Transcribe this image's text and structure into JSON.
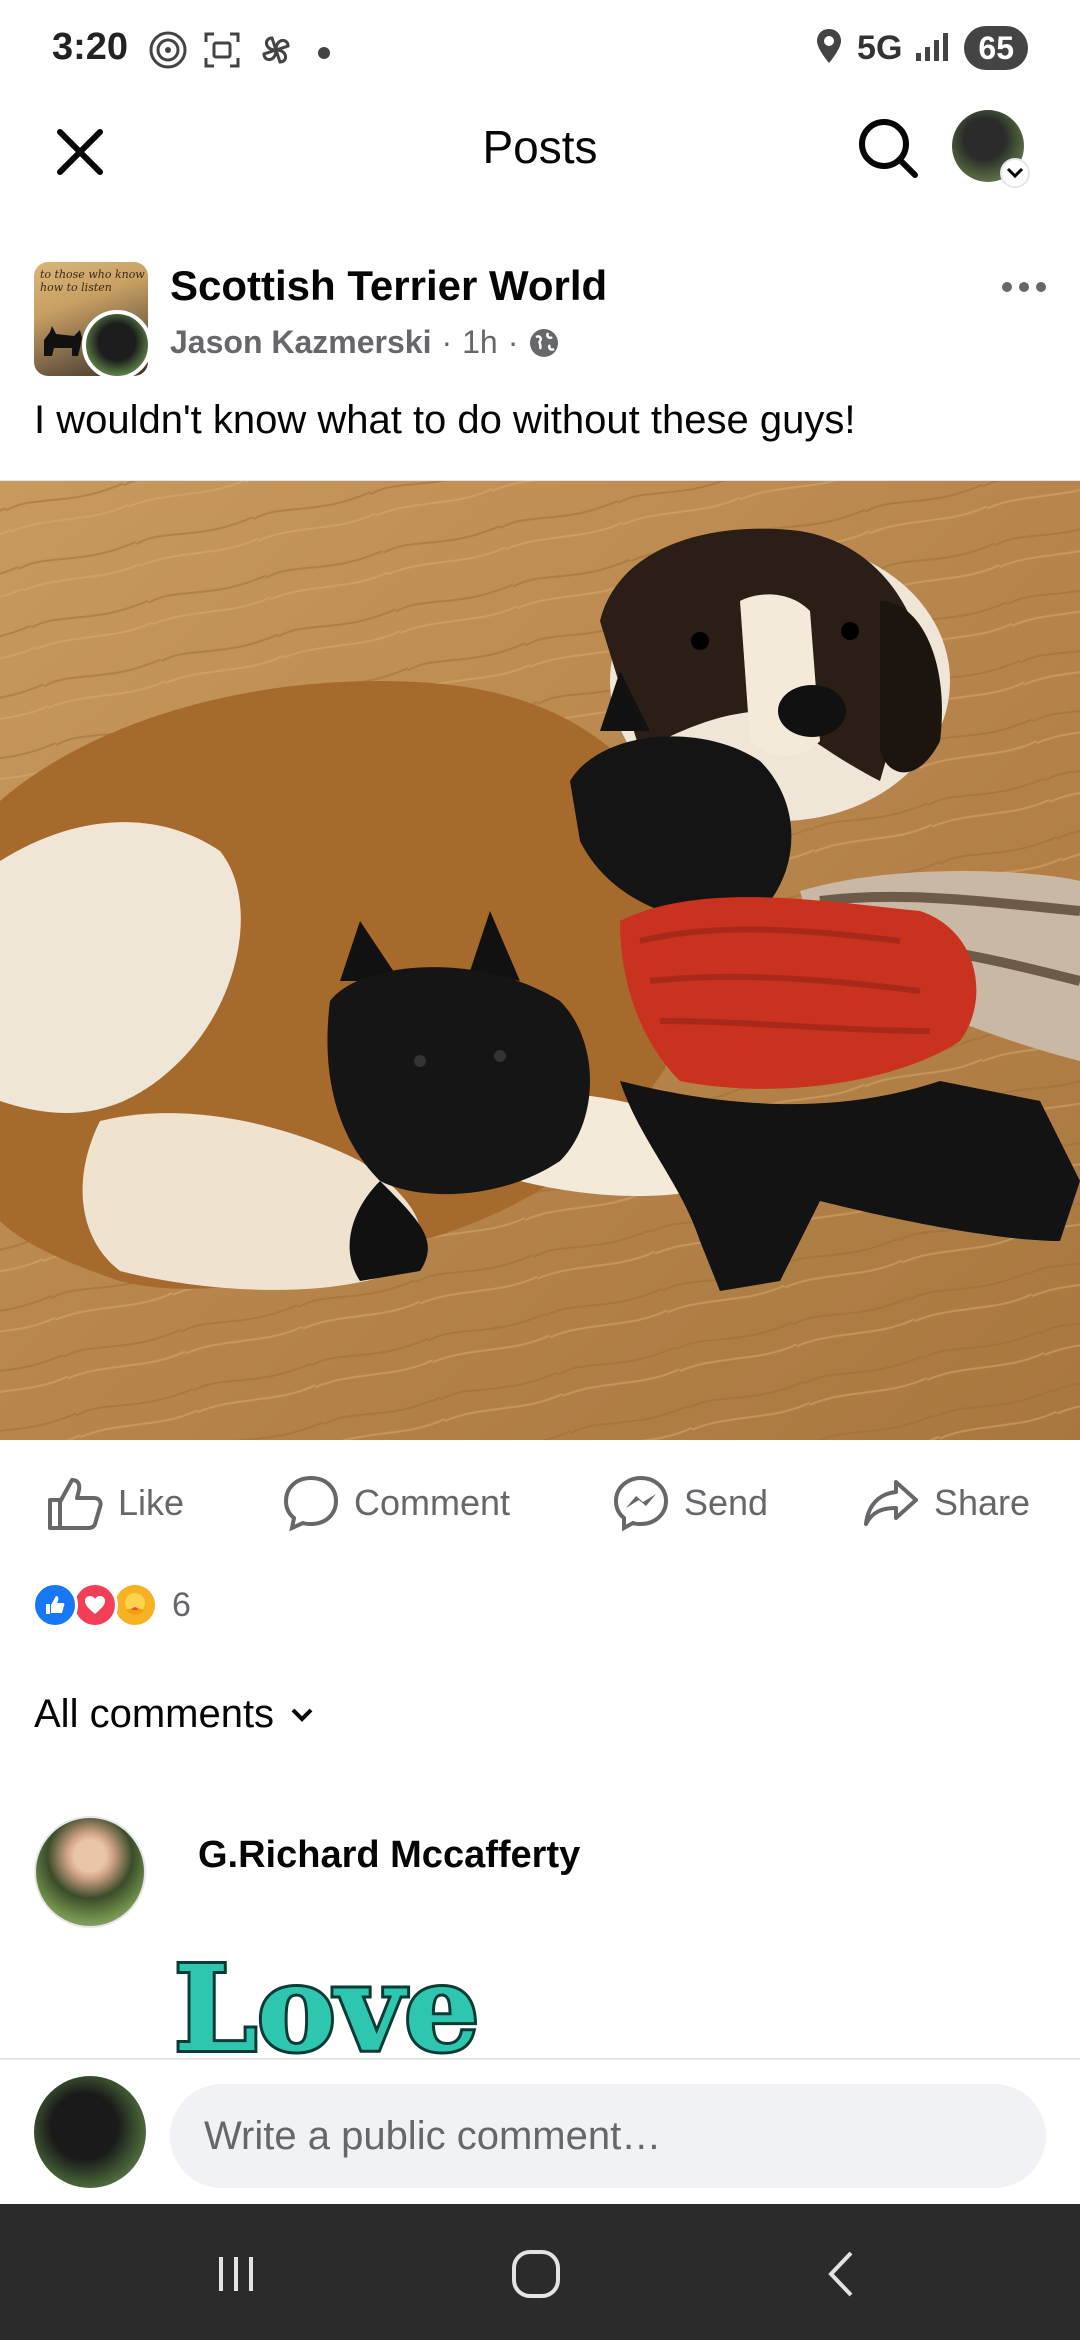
{
  "status_bar": {
    "time": "3:20",
    "network": "5G",
    "battery": "65"
  },
  "header": {
    "title": "Posts"
  },
  "post": {
    "group_name": "Scottish Terrier World",
    "group_pic_caption": "to those who know how to listen",
    "author": "Jason Kazmerski",
    "time": "1h",
    "separator": "·",
    "text": "I wouldn't know what to do without these guys!"
  },
  "actions": {
    "like": "Like",
    "comment": "Comment",
    "send": "Send",
    "share": "Share"
  },
  "reactions": {
    "count": "6",
    "types": [
      "like",
      "love",
      "care"
    ]
  },
  "comments_filter": {
    "label": "All comments"
  },
  "comment": {
    "author": "G.Richard Mccafferty",
    "sticker_text": "Love"
  },
  "composer": {
    "placeholder": "Write a public comment…"
  },
  "colors": {
    "brand_blue": "#1877f2",
    "love_red": "#f33e58",
    "care_yellow": "#f7b125",
    "sticker_teal": "#2fc6b0",
    "secondary_text": "#65676b"
  }
}
